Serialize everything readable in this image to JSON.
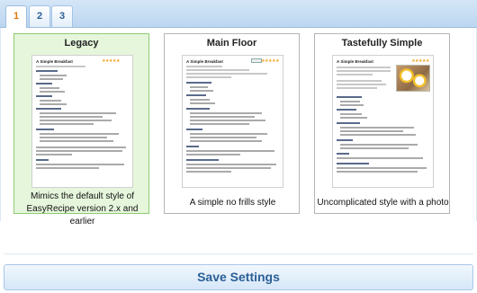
{
  "tabs": [
    {
      "label": "1",
      "active": true
    },
    {
      "label": "2",
      "active": false
    },
    {
      "label": "3",
      "active": false
    }
  ],
  "styles": [
    {
      "title": "Legacy",
      "selected": true,
      "description": "Mimics the default style of EasyRecipe version 2.x and earlier",
      "preview": {
        "heading": "A Simple Breakfast",
        "rating": "★★★★★",
        "has_photo": false
      }
    },
    {
      "title": "Main Floor",
      "selected": false,
      "description": "A simple no frills style",
      "preview": {
        "heading": "A Simple Breakfast",
        "rating": "★★★★★",
        "has_photo": false
      }
    },
    {
      "title": "Tastefully Simple",
      "selected": false,
      "description": "Uncomplicated style with a photo",
      "preview": {
        "heading": "A Simple Breakfast",
        "rating": "★★★★★",
        "has_photo": true
      }
    }
  ],
  "save_button": {
    "label": "Save Settings"
  },
  "colors": {
    "accent": "#2b5f96",
    "active_tab": "#e07810",
    "selected_card": "#e6f6dc",
    "selected_border": "#8ccc72"
  }
}
